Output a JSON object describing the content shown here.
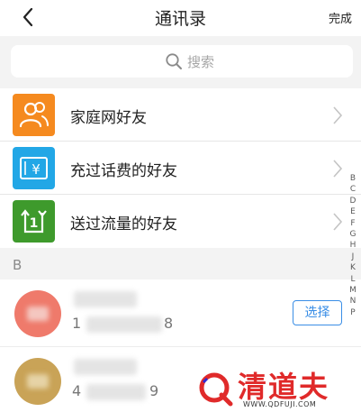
{
  "header": {
    "title": "通讯录",
    "done_label": "完成",
    "back_icon": "chevron-left-icon"
  },
  "search": {
    "placeholder": "搜索",
    "icon": "search-icon"
  },
  "menu_items": [
    {
      "label": "家庭网好友",
      "icon": "family-friends-icon",
      "color": "#f58a1f"
    },
    {
      "label": "充过话费的好友",
      "icon": "recharge-yen-icon",
      "color": "#22a7e6"
    },
    {
      "label": "送过流量的好友",
      "icon": "data-gift-icon",
      "color": "#3e9a2c"
    }
  ],
  "section": {
    "letter": "B"
  },
  "contacts": [
    {
      "name_visible": "",
      "phone_start": "1",
      "phone_end": "8",
      "avatar_color": "#ef7a6b",
      "action_label": "选择"
    },
    {
      "name_visible": "",
      "phone_start": "4",
      "phone_end": "9",
      "avatar_color": "#c9a357"
    }
  ],
  "index_letters": [
    "B",
    "C",
    "D",
    "E",
    "F",
    "G",
    "H",
    "J",
    "K",
    "L",
    "M",
    "N",
    "P"
  ],
  "watermark": {
    "brand": "清道夫",
    "url": "WWW.QDFUJI.COM"
  }
}
